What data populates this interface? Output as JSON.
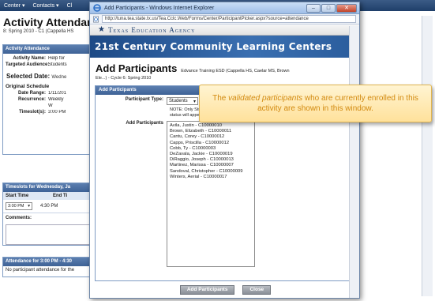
{
  "bg": {
    "nav": [
      "Center",
      "Contacts",
      "Cl"
    ],
    "title": "Activity Attendanc",
    "subtitle": "8: Spring 2010 - C1 (Cappella HS",
    "attendance_panel": {
      "header": "Activity Attendance",
      "activity_name_label": "Activity Name:",
      "activity_name_value": "Help for",
      "targeted_label": "Targeted Audience:",
      "targeted_value": "Students",
      "selected_date_label": "Selected Date:",
      "selected_date_value": "Wedne",
      "original_schedule_label": "Original Schedule",
      "date_range_label": "Date Range:",
      "date_range_value": "1/11/201",
      "recurrence_label": "Recurrence:",
      "recurrence_value": "Weekly",
      "recurrence_value2": "W",
      "timeslot_label": "Timeslot(s):",
      "timeslot_value": "3:00 PM"
    },
    "timeslots_panel": {
      "header": "Timeslots for Wednesday, Ja",
      "start_time_label": "Start Time",
      "end_time_label": "End Ti",
      "start_value": "3:00 PM",
      "end_value": "4:30 PM",
      "comments_label": "Comments:"
    },
    "attendance_for_panel": {
      "header": "Attendance for 3:00 PM - 4:30",
      "message": "No participant attendance for the"
    }
  },
  "popup": {
    "window_title": "Add Participants - Windows Internet Explorer",
    "address": "http://tuna.tea.state.tx.us/Tea.Cclc.Web/Forms/Center/ParticipantPicker.aspx?source=attendance",
    "tea_name": "Texas Education Agency",
    "banner": "21st Century Community Learning Centers",
    "heading": "Add Participants",
    "heading_info": "Edvance Training ESD (Cappella HS, Caelar MS, Brown",
    "heading_sub": "Ele...) - Cycle 6: Spring 2010",
    "section_header": "Add Participants",
    "participant_type_label": "Participant Type:",
    "participant_type_value": "Students",
    "note": "NOTE: Only Students that have a \"Validated\" status will appear in the list below.",
    "add_participants_label": "Add Participants",
    "participants": [
      "Avila, Justin - C10000010",
      "Brown, Elizabeth - C10000011",
      "Cantu, Corey - C10000012",
      "Capps, Priscilla - C10000012",
      "Cobb, Ty - C10000003",
      "DeZavala, Jackie - C10000019",
      "DiRaggio, Joseph - C10000013",
      "Martinez, Marissa - C10000007",
      "Sandoval, Christopher - C10000009",
      "Winters, Aerial - C10000017"
    ],
    "add_button": "Add Participants",
    "close_button": "Close"
  },
  "callout": {
    "pre": "The ",
    "emphasis": "validated participants",
    "post": " who are currently enrolled in this activity are shown in this window."
  },
  "colors": {
    "banner": "#2a5c9c",
    "panel_header": "#3e6296",
    "callout_text": "#d28a10",
    "callout_bg": "#ffe19b"
  }
}
